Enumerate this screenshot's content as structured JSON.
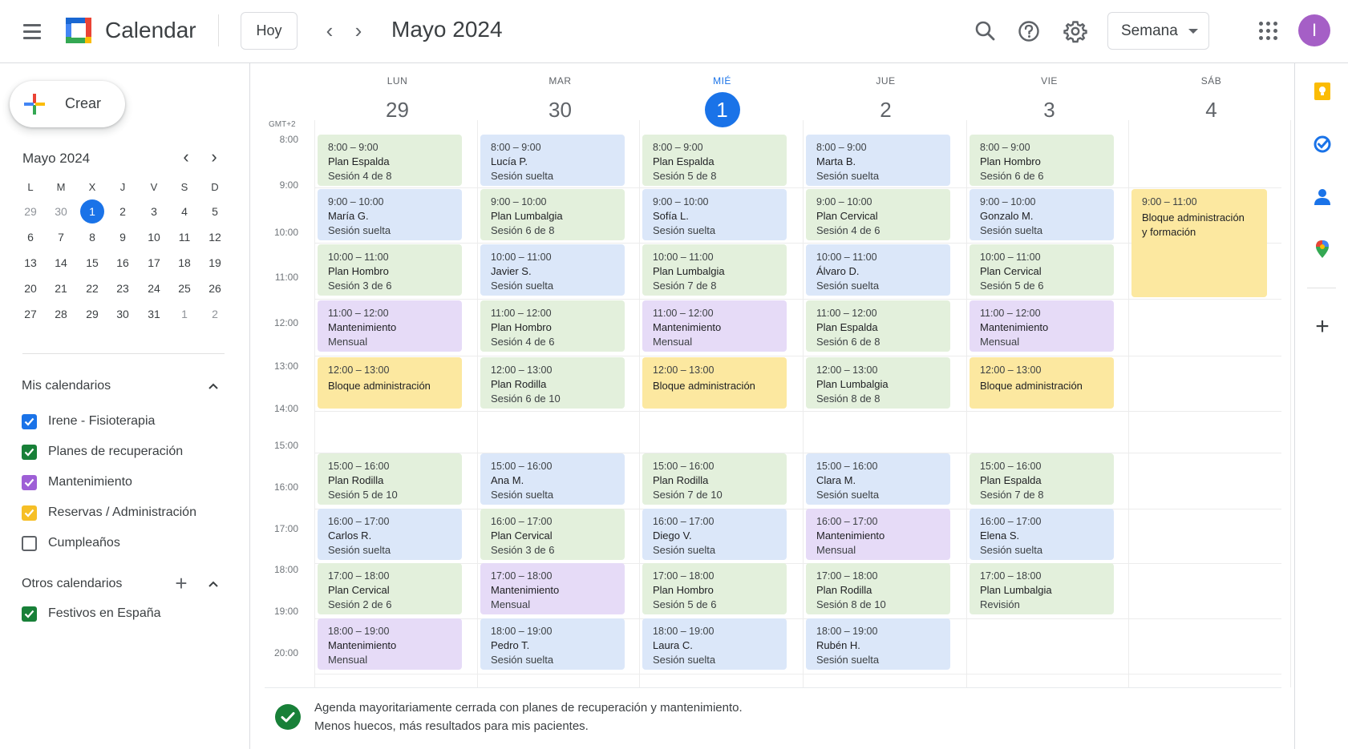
{
  "app": {
    "title": "Calendar",
    "avatar_initial": "I"
  },
  "toolbar": {
    "today_label": "Hoy",
    "period_title": "Mayo 2024",
    "view_label": "Semana"
  },
  "sidebar": {
    "create_label": "Crear",
    "mini_calendar": {
      "title": "Mayo 2024",
      "weekdays": [
        "L",
        "M",
        "X",
        "J",
        "V",
        "S",
        "D"
      ],
      "weeks": [
        [
          "29",
          "30",
          "1",
          "2",
          "3",
          "4",
          "5"
        ],
        [
          "6",
          "7",
          "8",
          "9",
          "10",
          "11",
          "12"
        ],
        [
          "13",
          "14",
          "15",
          "16",
          "17",
          "18",
          "19"
        ],
        [
          "20",
          "21",
          "22",
          "23",
          "24",
          "25",
          "26"
        ],
        [
          "27",
          "28",
          "29",
          "30",
          "31",
          "1",
          "2"
        ]
      ],
      "today": "1"
    },
    "my_calendars": {
      "title": "Mis calendarios",
      "items": [
        {
          "name": "Irene - Fisioterapia",
          "checked": true,
          "color": "#1a73e8"
        },
        {
          "name": "Planes de recuperación",
          "checked": true,
          "color": "#188038"
        },
        {
          "name": "Mantenimiento",
          "checked": true,
          "color": "#9e5fd6"
        },
        {
          "name": "Reservas / Administración",
          "checked": true,
          "color": "#f6bf26"
        },
        {
          "name": "Cumpleaños",
          "checked": false,
          "color": "#5f6368"
        }
      ]
    },
    "other_calendars": {
      "title": "Otros calendarios",
      "items": [
        {
          "name": "Festivos en España",
          "checked": true,
          "color": "#188038"
        }
      ]
    }
  },
  "week": {
    "timezone": "GMT+2",
    "days": [
      {
        "dow": "LUN",
        "num": "29",
        "today": false
      },
      {
        "dow": "MAR",
        "num": "30",
        "today": false
      },
      {
        "dow": "MIÉ",
        "num": "1",
        "today": true
      },
      {
        "dow": "JUE",
        "num": "2",
        "today": false
      },
      {
        "dow": "VIE",
        "num": "3",
        "today": false
      },
      {
        "dow": "SÁB",
        "num": "4",
        "today": false
      }
    ],
    "hours": [
      "8:00",
      "9:00",
      "10:00",
      "11:00",
      "12:00",
      "13:00",
      "14:00",
      "15:00",
      "16:00",
      "17:00",
      "18:00",
      "19:00",
      "20:00"
    ],
    "events": [
      {
        "day": 0,
        "start": 8,
        "end": 9,
        "color": "green",
        "time": "8:00 – 9:00",
        "title": "Plan Espalda",
        "sub": "Sesión 4 de 8"
      },
      {
        "day": 0,
        "start": 9,
        "end": 10,
        "color": "blue",
        "time": "9:00 – 10:00",
        "title": "María G.",
        "sub": "Sesión suelta"
      },
      {
        "day": 0,
        "start": 10,
        "end": 11,
        "color": "green",
        "time": "10:00 – 11:00",
        "title": "Plan Hombro",
        "sub": "Sesión 3 de 6"
      },
      {
        "day": 0,
        "start": 11,
        "end": 12,
        "color": "purple",
        "time": "11:00 – 12:00",
        "title": "Mantenimiento",
        "sub": "Mensual"
      },
      {
        "day": 0,
        "start": 12,
        "end": 13,
        "color": "yellow",
        "time": "12:00 – 13:00",
        "title": "Bloque administración",
        "sub": ""
      },
      {
        "day": 0,
        "start": 15,
        "end": 16,
        "color": "green",
        "time": "15:00 – 16:00",
        "title": "Plan Rodilla",
        "sub": "Sesión 5 de 10"
      },
      {
        "day": 0,
        "start": 16,
        "end": 17,
        "color": "blue",
        "time": "16:00 – 17:00",
        "title": "Carlos R.",
        "sub": "Sesión suelta"
      },
      {
        "day": 0,
        "start": 17,
        "end": 18,
        "color": "green",
        "time": "17:00 – 18:00",
        "title": "Plan Cervical",
        "sub": "Sesión 2 de 6"
      },
      {
        "day": 0,
        "start": 18,
        "end": 19,
        "color": "purple",
        "time": "18:00 – 19:00",
        "title": "Mantenimiento",
        "sub": "Mensual"
      },
      {
        "day": 1,
        "start": 8,
        "end": 9,
        "color": "blue",
        "time": "8:00 – 9:00",
        "title": "Lucía P.",
        "sub": "Sesión suelta"
      },
      {
        "day": 1,
        "start": 9,
        "end": 10,
        "color": "green",
        "time": "9:00 – 10:00",
        "title": "Plan Lumbalgia",
        "sub": "Sesión 6 de 8"
      },
      {
        "day": 1,
        "start": 10,
        "end": 11,
        "color": "blue",
        "time": "10:00 – 11:00",
        "title": "Javier S.",
        "sub": "Sesión suelta"
      },
      {
        "day": 1,
        "start": 11,
        "end": 12,
        "color": "green",
        "time": "11:00 – 12:00",
        "title": "Plan Hombro",
        "sub": "Sesión 4 de 6"
      },
      {
        "day": 1,
        "start": 12,
        "end": 13,
        "color": "green",
        "time": "12:00 – 13:00",
        "title": "Plan Rodilla",
        "sub": "Sesión 6 de 10"
      },
      {
        "day": 1,
        "start": 15,
        "end": 16,
        "color": "blue",
        "time": "15:00 – 16:00",
        "title": "Ana M.",
        "sub": "Sesión suelta"
      },
      {
        "day": 1,
        "start": 16,
        "end": 17,
        "color": "green",
        "time": "16:00 – 17:00",
        "title": "Plan Cervical",
        "sub": "Sesión 3 de 6"
      },
      {
        "day": 1,
        "start": 17,
        "end": 18,
        "color": "purple",
        "time": "17:00 – 18:00",
        "title": "Mantenimiento",
        "sub": "Mensual"
      },
      {
        "day": 1,
        "start": 18,
        "end": 19,
        "color": "blue",
        "time": "18:00 – 19:00",
        "title": "Pedro T.",
        "sub": "Sesión suelta"
      },
      {
        "day": 2,
        "start": 8,
        "end": 9,
        "color": "green",
        "time": "8:00 – 9:00",
        "title": "Plan Espalda",
        "sub": "Sesión 5 de 8"
      },
      {
        "day": 2,
        "start": 9,
        "end": 10,
        "color": "blue",
        "time": "9:00 – 10:00",
        "title": "Sofía L.",
        "sub": "Sesión suelta"
      },
      {
        "day": 2,
        "start": 10,
        "end": 11,
        "color": "green",
        "time": "10:00 – 11:00",
        "title": "Plan Lumbalgia",
        "sub": "Sesión 7 de 8"
      },
      {
        "day": 2,
        "start": 11,
        "end": 12,
        "color": "purple",
        "time": "11:00 – 12:00",
        "title": "Mantenimiento",
        "sub": "Mensual"
      },
      {
        "day": 2,
        "start": 12,
        "end": 13,
        "color": "yellow",
        "time": "12:00 – 13:00",
        "title": "Bloque administración",
        "sub": ""
      },
      {
        "day": 2,
        "start": 15,
        "end": 16,
        "color": "green",
        "time": "15:00 – 16:00",
        "title": "Plan Rodilla",
        "sub": "Sesión 7 de 10"
      },
      {
        "day": 2,
        "start": 16,
        "end": 17,
        "color": "blue",
        "time": "16:00 – 17:00",
        "title": "Diego V.",
        "sub": "Sesión suelta"
      },
      {
        "day": 2,
        "start": 17,
        "end": 18,
        "color": "green",
        "time": "17:00 – 18:00",
        "title": "Plan Hombro",
        "sub": "Sesión 5 de 6"
      },
      {
        "day": 2,
        "start": 18,
        "end": 19,
        "color": "blue",
        "time": "18:00 – 19:00",
        "title": "Laura C.",
        "sub": "Sesión suelta"
      },
      {
        "day": 3,
        "start": 8,
        "end": 9,
        "color": "blue",
        "time": "8:00 – 9:00",
        "title": "Marta B.",
        "sub": "Sesión suelta"
      },
      {
        "day": 3,
        "start": 9,
        "end": 10,
        "color": "green",
        "time": "9:00 – 10:00",
        "title": "Plan Cervical",
        "sub": "Sesión 4 de 6"
      },
      {
        "day": 3,
        "start": 10,
        "end": 11,
        "color": "blue",
        "time": "10:00 – 11:00",
        "title": "Álvaro D.",
        "sub": "Sesión suelta"
      },
      {
        "day": 3,
        "start": 11,
        "end": 12,
        "color": "green",
        "time": "11:00 – 12:00",
        "title": "Plan Espalda",
        "sub": "Sesión 6 de 8"
      },
      {
        "day": 3,
        "start": 12,
        "end": 13,
        "color": "green",
        "time": "12:00 – 13:00",
        "title": "Plan Lumbalgia",
        "sub": "Sesión 8 de 8"
      },
      {
        "day": 3,
        "start": 15,
        "end": 16,
        "color": "blue",
        "time": "15:00 – 16:00",
        "title": "Clara M.",
        "sub": "Sesión suelta"
      },
      {
        "day": 3,
        "start": 16,
        "end": 17,
        "color": "purple",
        "time": "16:00 – 17:00",
        "title": "Mantenimiento",
        "sub": "Mensual"
      },
      {
        "day": 3,
        "start": 17,
        "end": 18,
        "color": "green",
        "time": "17:00 – 18:00",
        "title": "Plan Rodilla",
        "sub": "Sesión 8 de 10"
      },
      {
        "day": 3,
        "start": 18,
        "end": 19,
        "color": "blue",
        "time": "18:00 – 19:00",
        "title": "Rubén H.",
        "sub": "Sesión suelta"
      },
      {
        "day": 4,
        "start": 8,
        "end": 9,
        "color": "green",
        "time": "8:00 – 9:00",
        "title": "Plan Hombro",
        "sub": "Sesión 6 de 6"
      },
      {
        "day": 4,
        "start": 9,
        "end": 10,
        "color": "blue",
        "time": "9:00 – 10:00",
        "title": "Gonzalo M.",
        "sub": "Sesión suelta"
      },
      {
        "day": 4,
        "start": 10,
        "end": 11,
        "color": "green",
        "time": "10:00 – 11:00",
        "title": "Plan Cervical",
        "sub": "Sesión 5 de 6"
      },
      {
        "day": 4,
        "start": 11,
        "end": 12,
        "color": "purple",
        "time": "11:00 – 12:00",
        "title": "Mantenimiento",
        "sub": "Mensual"
      },
      {
        "day": 4,
        "start": 12,
        "end": 13,
        "color": "yellow",
        "time": "12:00 – 13:00",
        "title": "Bloque administración",
        "sub": ""
      },
      {
        "day": 4,
        "start": 15,
        "end": 16,
        "color": "green",
        "time": "15:00 – 16:00",
        "title": "Plan Espalda",
        "sub": "Sesión 7 de 8"
      },
      {
        "day": 4,
        "start": 16,
        "end": 17,
        "color": "blue",
        "time": "16:00 – 17:00",
        "title": "Elena S.",
        "sub": "Sesión suelta"
      },
      {
        "day": 4,
        "start": 17,
        "end": 18,
        "color": "green",
        "time": "17:00 – 18:00",
        "title": "Plan Lumbalgia",
        "sub": "Revisión"
      },
      {
        "day": 5,
        "start": 9,
        "end": 11,
        "color": "yellow",
        "time": "9:00 – 11:00",
        "title": "Bloque administración y formación",
        "sub": ""
      }
    ]
  },
  "footer": {
    "line1": "Agenda mayoritariamente cerrada con planes de recuperación y mantenimiento.",
    "line2": "Menos huecos, más resultados para mis pacientes."
  },
  "colors": {
    "accent": "#1a73e8",
    "green_event": "#e3f0dc",
    "blue_event": "#dbe7f9",
    "purple_event": "#e6dbf7",
    "yellow_event": "#fce8a0"
  },
  "icons": [
    "menu-icon",
    "calendar-logo-icon",
    "chevron-left-icon",
    "chevron-right-icon",
    "search-icon",
    "help-icon",
    "gear-icon",
    "caret-down-icon",
    "apps-grid-icon",
    "plus-icon",
    "chevron-up-icon",
    "check-icon",
    "keep-icon",
    "tasks-icon",
    "contacts-icon",
    "maps-icon"
  ]
}
